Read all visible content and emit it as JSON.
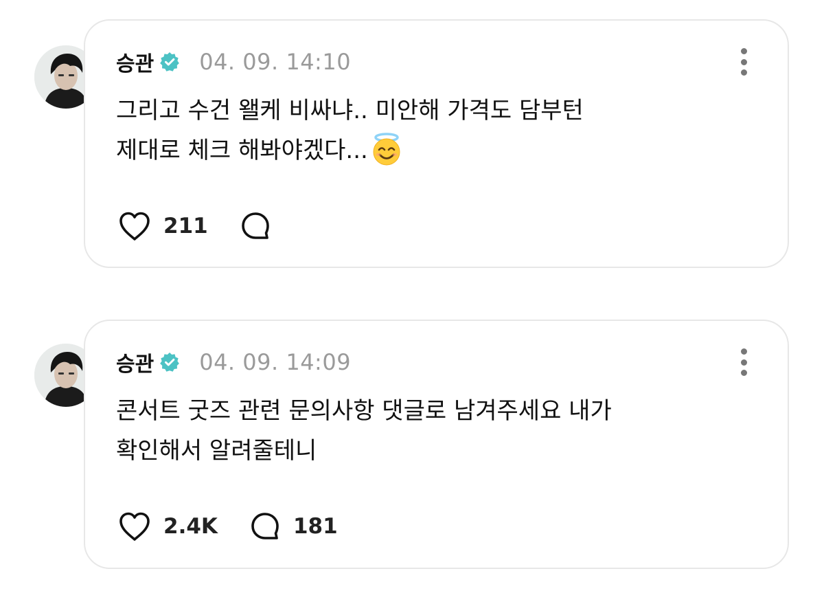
{
  "posts": [
    {
      "username": "승관",
      "timestamp": "04. 09. 14:10",
      "text_lines": [
        "그리고 수건 왤케 비싸냐.. 미안해 가격도 담부턴",
        "제대로 체크 해봐야겠다..."
      ],
      "emoji": "smiling-face-with-halo",
      "likes": "211",
      "replies": ""
    },
    {
      "username": "승관",
      "timestamp": "04. 09. 14:09",
      "text_lines": [
        "콘서트 굿즈 관련 문의사항 댓글로 남겨주세요 내가",
        "확인해서 알려줄테니"
      ],
      "likes": "2.4K",
      "replies": "181"
    }
  ],
  "icons": {
    "verified": "verified-badge-icon",
    "more": "more-vertical-icon",
    "like": "heart-icon",
    "reply": "reply-bubble-icon"
  },
  "colors": {
    "verified": "#4cc2c4",
    "timestamp": "#9a9a9a",
    "card_border": "#e7e7e7"
  }
}
